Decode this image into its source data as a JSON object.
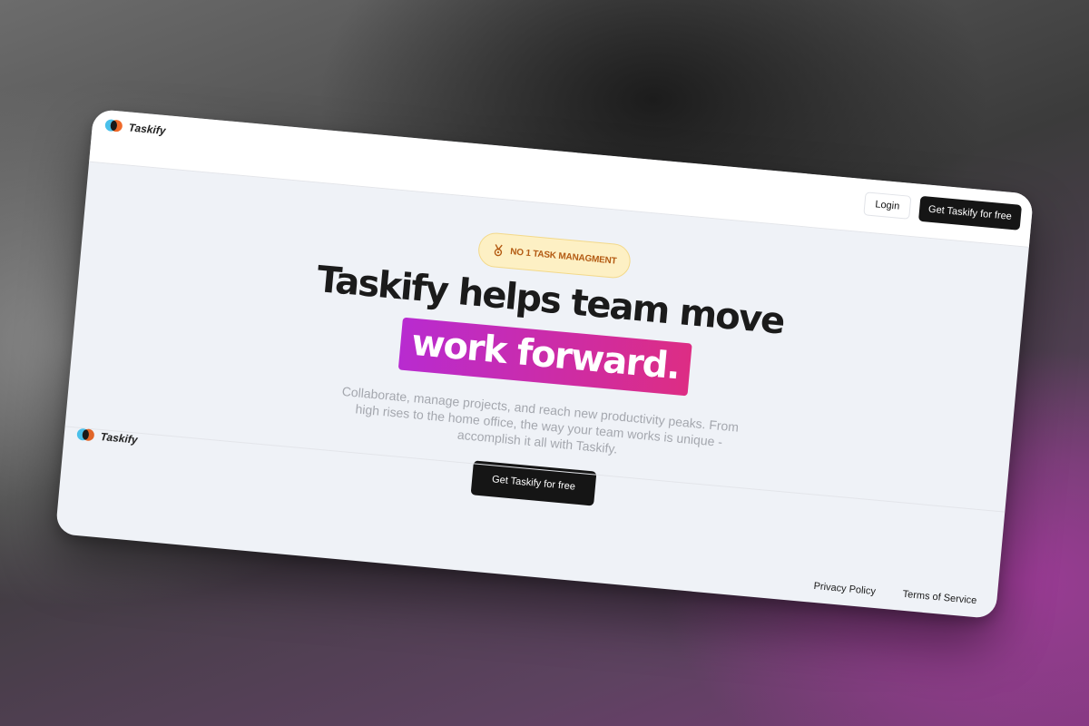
{
  "brand": {
    "name": "Taskify",
    "logo_icon": "taskify-logo-icon"
  },
  "nav": {
    "login_label": "Login",
    "cta_label": "Get Taskify for free"
  },
  "hero": {
    "badge_icon": "medal-icon",
    "badge_label": "NO 1 TASK MANAGMENT",
    "headline": "Taskify helps team move",
    "highlight": "work forward.",
    "subtitle": "Collaborate, manage projects, and reach new productivity peaks. From high rises to the home office, the way your team works is unique -accomplish it all with Taskify.",
    "cta_label": "Get Taskify for free"
  },
  "footer": {
    "brand_name": "Taskify",
    "links": [
      "Privacy Policy",
      "Terms of Service"
    ]
  },
  "colors": {
    "highlight_start": "#b82bd0",
    "highlight_end": "#dd2d84",
    "badge_bg": "#fdf0c4",
    "badge_text": "#b35a12",
    "dark_button": "#151515"
  }
}
